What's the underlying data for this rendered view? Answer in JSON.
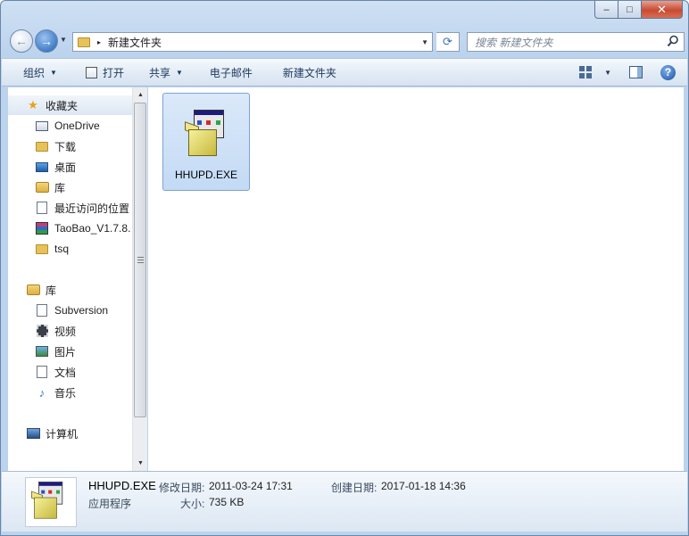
{
  "window": {
    "caption": {
      "minimize": "–",
      "maximize": "□",
      "close": "✕"
    }
  },
  "address": {
    "back_glyph": "←",
    "forward_glyph": "→",
    "separator": "▸",
    "path": "新建文件夹",
    "dropdown": "▼",
    "refresh_glyph": "⟳",
    "search_placeholder": "搜索 新建文件夹",
    "search_icon": "search-icon"
  },
  "toolbar": {
    "organize": "组织",
    "open": "打开",
    "share": "共享",
    "email": "电子邮件",
    "new_folder": "新建文件夹",
    "arrow": "▼",
    "help": "?"
  },
  "nav": {
    "favorites": {
      "label": "收藏夹",
      "icon": "star-icon",
      "items": [
        {
          "label": "OneDrive",
          "icon": "onedrive-icon"
        },
        {
          "label": "下载",
          "icon": "downloads-folder-icon"
        },
        {
          "label": "桌面",
          "icon": "desktop-icon"
        },
        {
          "label": "库",
          "icon": "library-icon"
        },
        {
          "label": "最近访问的位置",
          "icon": "recent-places-icon"
        },
        {
          "label": "TaoBao_V1.7.8.",
          "icon": "winrar-icon"
        },
        {
          "label": "tsq",
          "icon": "folder-icon"
        }
      ]
    },
    "libraries": {
      "label": "库",
      "icon": "library-icon",
      "items": [
        {
          "label": "Subversion",
          "icon": "subversion-icon"
        },
        {
          "label": "视频",
          "icon": "video-icon"
        },
        {
          "label": "图片",
          "icon": "pictures-icon"
        },
        {
          "label": "文档",
          "icon": "documents-icon"
        },
        {
          "label": "音乐",
          "icon": "music-icon"
        }
      ]
    },
    "computer": {
      "label": "计算机",
      "icon": "computer-icon"
    },
    "scroll": {
      "up": "▲",
      "down": "▼"
    }
  },
  "content": {
    "files": [
      {
        "name": "HHUPD.EXE",
        "icon": "installer-icon",
        "selected": true
      }
    ]
  },
  "details": {
    "name": "HHUPD.EXE",
    "type": "应用程序",
    "modified_label": "修改日期:",
    "modified_value": "2011-03-24 17:31",
    "created_label": "创建日期:",
    "created_value": "2017-01-18 14:36",
    "size_label": "大小:",
    "size_value": "735 KB"
  }
}
